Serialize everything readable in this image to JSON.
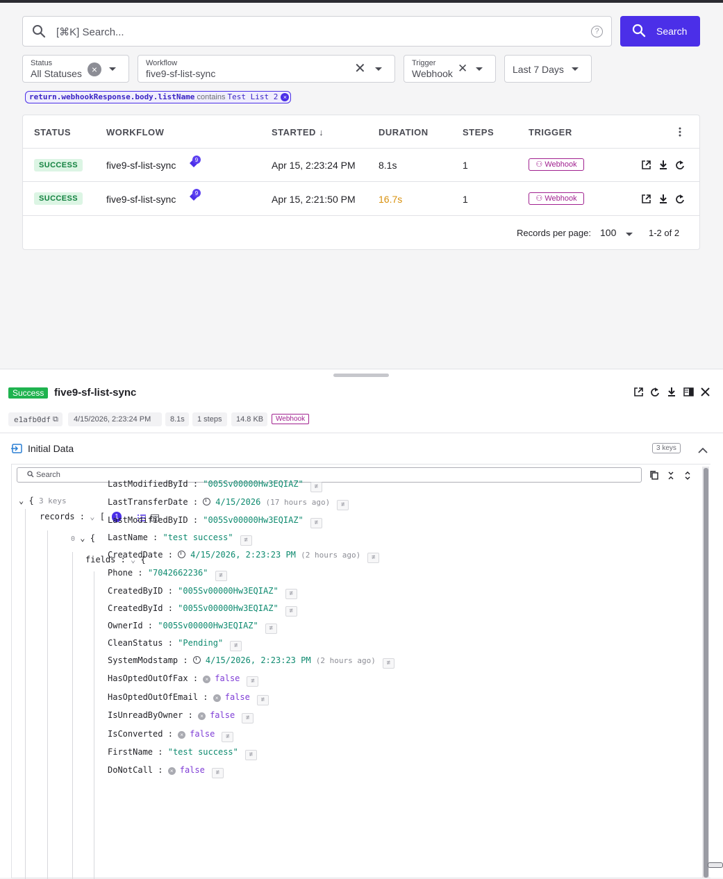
{
  "search": {
    "placeholder": "[⌘K] Search...",
    "button_label": "Search",
    "help": "?"
  },
  "filters": {
    "status": {
      "label": "Status",
      "value": "All Statuses"
    },
    "workflow": {
      "label": "Workflow",
      "value": "five9-sf-list-sync"
    },
    "trigger": {
      "label": "Trigger",
      "value": "Webhook"
    },
    "date": {
      "value": "Last 7 Days"
    }
  },
  "active_filter": {
    "key": "return.webhookResponse.body.listName",
    "op": "contains",
    "value": "Test List 2"
  },
  "table": {
    "headers": {
      "status": "STATUS",
      "workflow": "WORKFLOW",
      "started": "STARTED",
      "duration": "DURATION",
      "steps": "STEPS",
      "trigger": "TRIGGER"
    },
    "rows": [
      {
        "status": "SUCCESS",
        "workflow": "five9-sf-list-sync",
        "tag_count": "9",
        "started": "Apr 15, 2:23:24 PM",
        "duration": "8.1s",
        "steps": "1",
        "trigger": "Webhook"
      },
      {
        "status": "SUCCESS",
        "workflow": "five9-sf-list-sync",
        "tag_count": "9",
        "started": "Apr 15, 2:21:50 PM",
        "duration": "16.7s",
        "steps": "1",
        "trigger": "Webhook"
      }
    ],
    "footer": {
      "records_label": "Records per page:",
      "per_page": "100",
      "range": "1-2 of 2"
    }
  },
  "detail": {
    "status": "Success",
    "title": "five9-sf-list-sync",
    "meta": {
      "id": "e1afb0df",
      "date": "4/15/2026, 2:23:24 PM",
      "duration": "8.1s",
      "steps": "1 steps",
      "size": "14.8 KB",
      "trigger": "Webhook"
    },
    "section_title": "Initial Data",
    "keys_badge": "3 keys",
    "json_search_placeholder": "Search",
    "tree": {
      "root_open": "{",
      "root_keys": "3 keys",
      "records_key": "records",
      "records_open": "[",
      "records_count": "1",
      "index0": "0",
      "index0_open": "{",
      "fields_key": "fields",
      "fields_open": "{",
      "fields": [
        {
          "key": "LastModifiedById",
          "value": "\"005Sv00000Hw3EQIAZ\"",
          "type": "str"
        },
        {
          "key": "LastTransferDate",
          "value": "4/15/2026",
          "rel": "(17 hours ago)",
          "type": "date"
        },
        {
          "key": "LastModifiedByID",
          "value": "\"005Sv00000Hw3EQIAZ\"",
          "type": "str"
        },
        {
          "key": "LastName",
          "value": "\"test success\"",
          "type": "str"
        },
        {
          "key": "CreatedDate",
          "value": "4/15/2026, 2:23:23 PM",
          "rel": "(2 hours ago)",
          "type": "date"
        },
        {
          "key": "Phone",
          "value": "\"7042662236\"",
          "type": "str"
        },
        {
          "key": "CreatedByID",
          "value": "\"005Sv00000Hw3EQIAZ\"",
          "type": "str"
        },
        {
          "key": "CreatedById",
          "value": "\"005Sv00000Hw3EQIAZ\"",
          "type": "str"
        },
        {
          "key": "OwnerId",
          "value": "\"005Sv00000Hw3EQIAZ\"",
          "type": "str"
        },
        {
          "key": "CleanStatus",
          "value": "\"Pending\"",
          "type": "str"
        },
        {
          "key": "SystemModstamp",
          "value": "4/15/2026, 2:23:23 PM",
          "rel": "(2 hours ago)",
          "type": "date"
        },
        {
          "key": "HasOptedOutOfFax",
          "value": "false",
          "type": "bool"
        },
        {
          "key": "HasOptedOutOfEmail",
          "value": "false",
          "type": "bool"
        },
        {
          "key": "IsUnreadByOwner",
          "value": "false",
          "type": "bool"
        },
        {
          "key": "IsConverted",
          "value": "false",
          "type": "bool"
        },
        {
          "key": "FirstName",
          "value": "\"test success\"",
          "type": "str"
        },
        {
          "key": "DoNotCall",
          "value": "false",
          "type": "bool"
        }
      ]
    }
  },
  "colors": {
    "accent": "#4b2fe8",
    "success": "#1fb34f",
    "webhook": "#a0208f",
    "duration_warn": "#d8900c"
  }
}
